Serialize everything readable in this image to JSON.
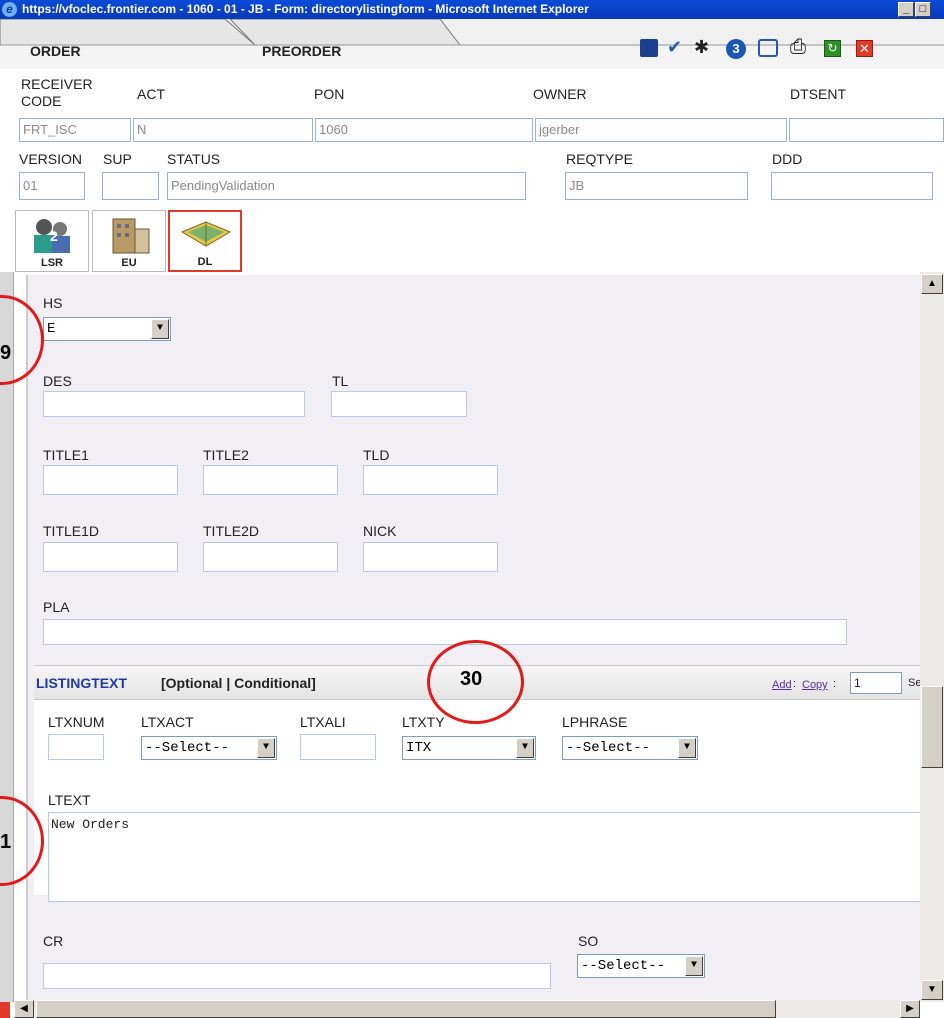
{
  "window": {
    "title": "https://vfoclec.frontier.com - 1060 - 01 - JB - Form: directorylistingform - Microsoft Internet Explorer",
    "minimize": "_",
    "restore": "□"
  },
  "tabs": [
    {
      "label": "ORDER"
    },
    {
      "label": "PREORDER"
    }
  ],
  "toolbar": {
    "save_icon": "floppy-disk-icon",
    "validate_icon": "checkmark-icon",
    "run_icon": "running-man-icon",
    "count_badge": "3",
    "book_icon": "book-icon",
    "print_icon": "printer-icon",
    "refresh_icon": "refresh-icon",
    "close_icon": "red-x-icon"
  },
  "header": {
    "row1_labels": {
      "receiver": "RECEIVER CODE",
      "act": "ACT",
      "pon": "PON",
      "owner": "OWNER",
      "dtsent": "DTSENT"
    },
    "row1_values": {
      "receiver": "FRT_ISC",
      "act": "N",
      "pon": "1060",
      "owner": "jgerber",
      "dtsent": ""
    },
    "row2_labels": {
      "version": "VERSION",
      "sup": "SUP",
      "status": "STATUS",
      "reqtype": "REQTYPE",
      "ddd": "DDD"
    },
    "row2_values": {
      "version": "01",
      "sup": "",
      "status": "PendingValidation",
      "reqtype": "JB",
      "ddd": ""
    }
  },
  "icons": [
    {
      "caption": "LSR"
    },
    {
      "caption": "EU"
    },
    {
      "caption": "DL"
    }
  ],
  "form": {
    "hs_label": "HS",
    "hs_value": "E",
    "des_label": "DES",
    "tl_label": "TL",
    "title1_label": "TITLE1",
    "title2_label": "TITLE2",
    "tld_label": "TLD",
    "title1d_label": "TITLE1D",
    "title2d_label": "TITLE2D",
    "nick_label": "NICK",
    "pla_label": "PLA",
    "listingtext": {
      "title": "LISTINGTEXT",
      "qualifier": "[Optional | Conditional]",
      "add_link": "Add",
      "sep1": " : ",
      "copy_link": "Copy",
      "sep2": " : ",
      "copy_count": "1",
      "trailing": "Se",
      "ltxnum_label": "LTXNUM",
      "ltxact_label": "LTXACT",
      "ltxact_value": "--Select--",
      "ltxali_label": "LTXALI",
      "ltxty_label": "LTXTY",
      "ltxty_value": "ITX",
      "lphrase_label": "LPHRASE",
      "lphrase_value": "--Select--",
      "ltext_label": "LTEXT",
      "ltext_value": "New Orders"
    },
    "cr_label": "CR",
    "so_label": "SO",
    "so_value": "--Select--"
  },
  "annotations": {
    "left_top_num": "9",
    "mid_num": "30",
    "left_bottom_num": "1"
  },
  "colors": {
    "titlebar": "#0a4bd8",
    "callout": "#e01b1b",
    "section_title": "#1e3aa8",
    "active_icon_border": "#e23a2a"
  }
}
